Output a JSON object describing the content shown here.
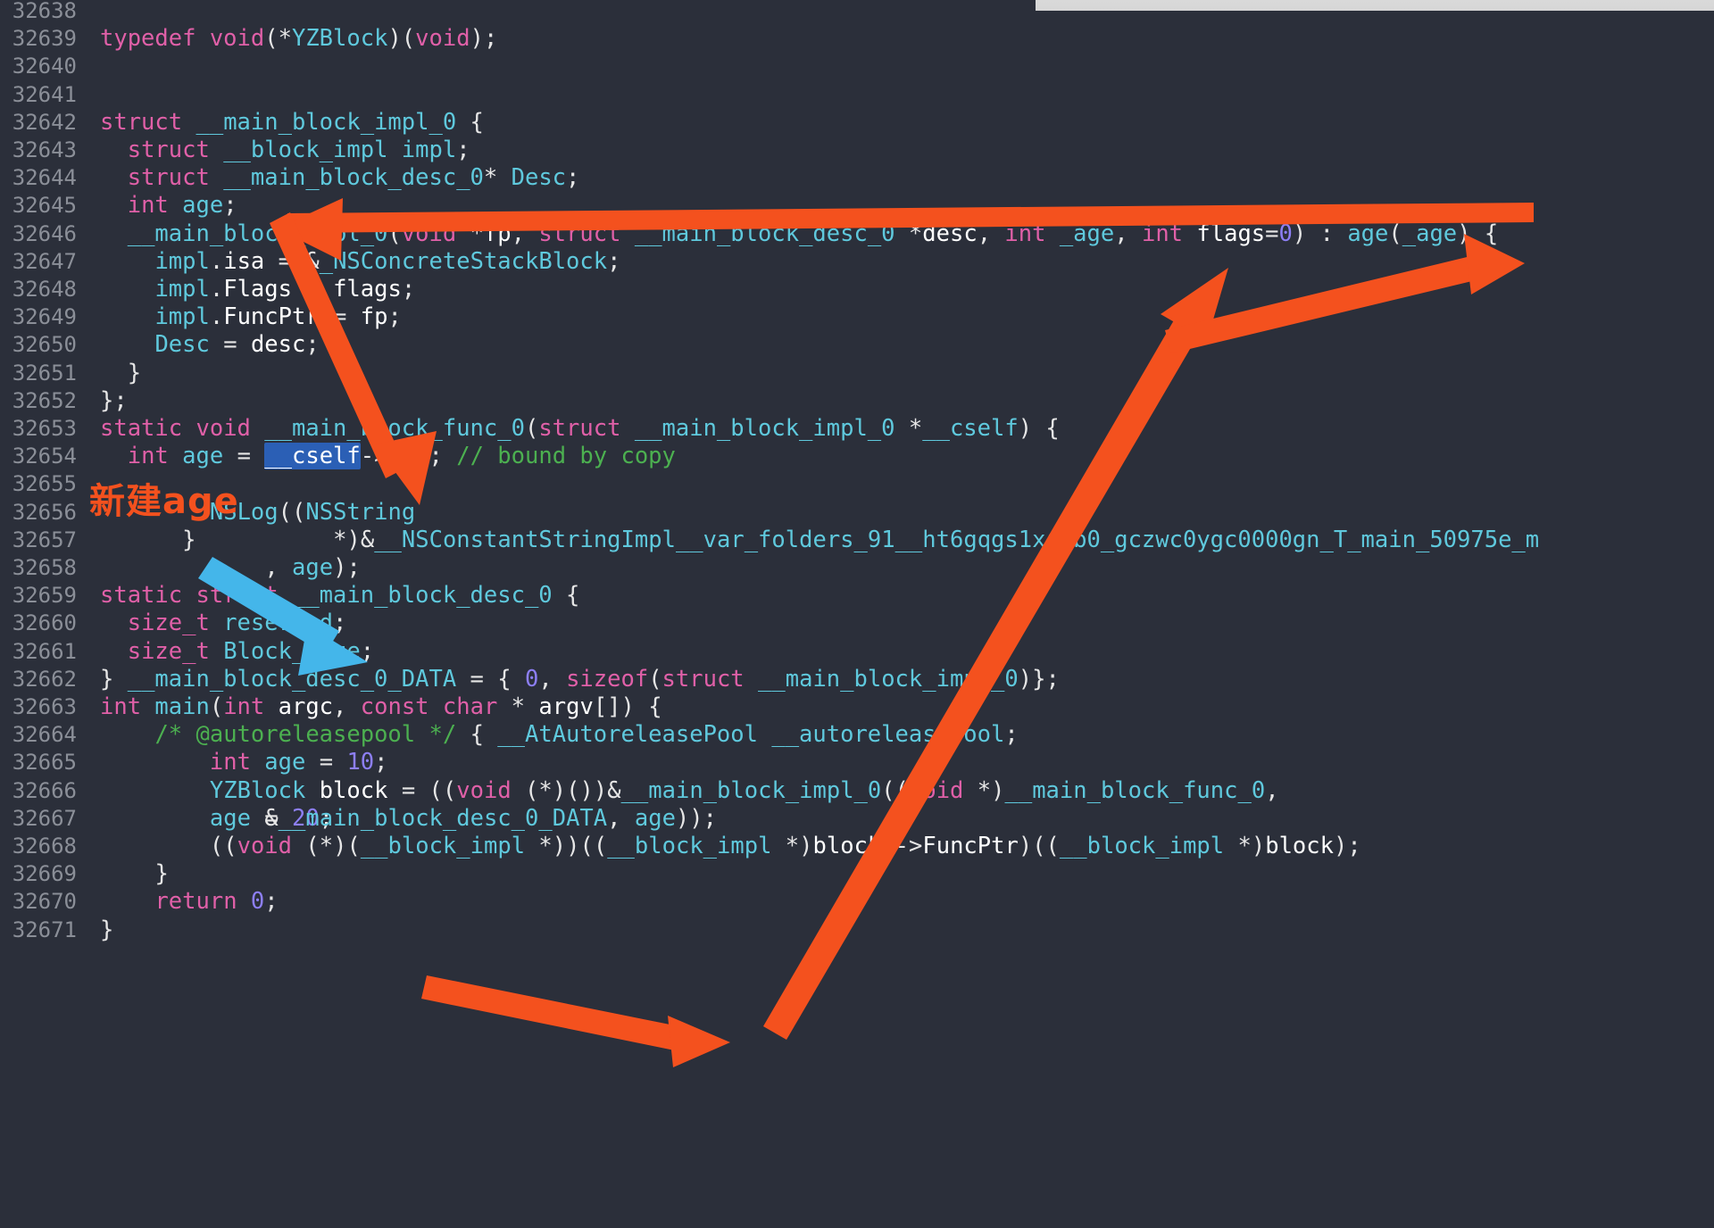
{
  "editor": {
    "theme_background": "#2b2f3a",
    "gutter_color": "#8b8f98",
    "selection_color": "#2b5fb5",
    "annotation_color": "#f4511e",
    "annotation_secondary_color": "#44b6ea",
    "first_line_partial": "32638",
    "lines": [
      {
        "n": "32639",
        "text": "typedef void(*YZBlock)(void);"
      },
      {
        "n": "32640",
        "text": ""
      },
      {
        "n": "32641",
        "text": ""
      },
      {
        "n": "32642",
        "text": "struct __main_block_impl_0 {"
      },
      {
        "n": "32643",
        "text": "  struct __block_impl impl;"
      },
      {
        "n": "32644",
        "text": "  struct __main_block_desc_0* Desc;"
      },
      {
        "n": "32645",
        "text": "  int age;"
      },
      {
        "n": "32646",
        "text": "  __main_block_impl_0(void *fp, struct __main_block_desc_0 *desc, int _age, int flags=0) : age(_age) {"
      },
      {
        "n": "32647",
        "text": "    impl.isa = &_NSConcreteStackBlock;"
      },
      {
        "n": "32648",
        "text": "    impl.Flags = flags;"
      },
      {
        "n": "32649",
        "text": "    impl.FuncPtr = fp;"
      },
      {
        "n": "32650",
        "text": "    Desc = desc;"
      },
      {
        "n": "32651",
        "text": "  }"
      },
      {
        "n": "32652",
        "text": "};"
      },
      {
        "n": "32653",
        "text": "static void __main_block_func_0(struct __main_block_impl_0 *__cself) {"
      },
      {
        "n": "32654",
        "text": "  int age = __cself->age; // bound by copy"
      },
      {
        "n": "32655",
        "text": ""
      },
      {
        "n": "32656",
        "text": "        NSLog((NSString *)&__NSConstantStringImpl__var_folders_91__ht6gqgs1xj8b0_gczwc0ygc0000gn_T_main_50975e_m, age);"
      },
      {
        "n": "32657",
        "text": "      }"
      },
      {
        "n": "32658",
        "text": ""
      },
      {
        "n": "32659",
        "text": "static struct __main_block_desc_0 {"
      },
      {
        "n": "32660",
        "text": "  size_t reserved;"
      },
      {
        "n": "32661",
        "text": "  size_t Block_size;"
      },
      {
        "n": "32662",
        "text": "} __main_block_desc_0_DATA = { 0, sizeof(struct __main_block_impl_0)};"
      },
      {
        "n": "32663",
        "text": "int main(int argc, const char * argv[]) {"
      },
      {
        "n": "32664",
        "text": "    /* @autoreleasepool */ { __AtAutoreleasePool __autoreleasepool;"
      },
      {
        "n": "32665",
        "text": "        int age = 10;"
      },
      {
        "n": "32666",
        "text": "        YZBlock block = ((void (*)())&__main_block_impl_0((void *)__main_block_func_0, &__main_block_desc_0_DATA, age));"
      },
      {
        "n": "32667",
        "text": "        age = 20;"
      },
      {
        "n": "32668",
        "text": "        ((void (*)(__block_impl *))((__block_impl *)block)->FuncPtr)((__block_impl *)block);"
      },
      {
        "n": "32669",
        "text": "    }"
      },
      {
        "n": "32670",
        "text": "    return 0;"
      },
      {
        "n": "32671",
        "text": "}"
      }
    ]
  },
  "annotations": {
    "chinese_note": "新建age",
    "selected_token": "__cself",
    "comment_text": "// bound by copy",
    "arrows": [
      {
        "name": "arrow-age-member-from-init",
        "color": "#f4511e",
        "from": "line 32646 right",
        "to": "line 32645 int age"
      },
      {
        "name": "arrow-age-member-to-func",
        "color": "#f4511e",
        "from": "line 32644/32645",
        "to": "line 32653 __main_block_func_0"
      },
      {
        "name": "arrow-main-age-to-init-param",
        "color": "#f4511e",
        "from": "line 32666 age argument",
        "to": "line 32646 age(_age)"
      },
      {
        "name": "arrow-main-age-value",
        "color": "#f4511e",
        "from": "line 32665 int age = 10",
        "to": "line 32666 age))"
      },
      {
        "name": "arrow-cself-to-nslog",
        "color": "#44b6ea",
        "from": "line 32654 int age",
        "to": "line 32656 NSLog"
      }
    ]
  }
}
